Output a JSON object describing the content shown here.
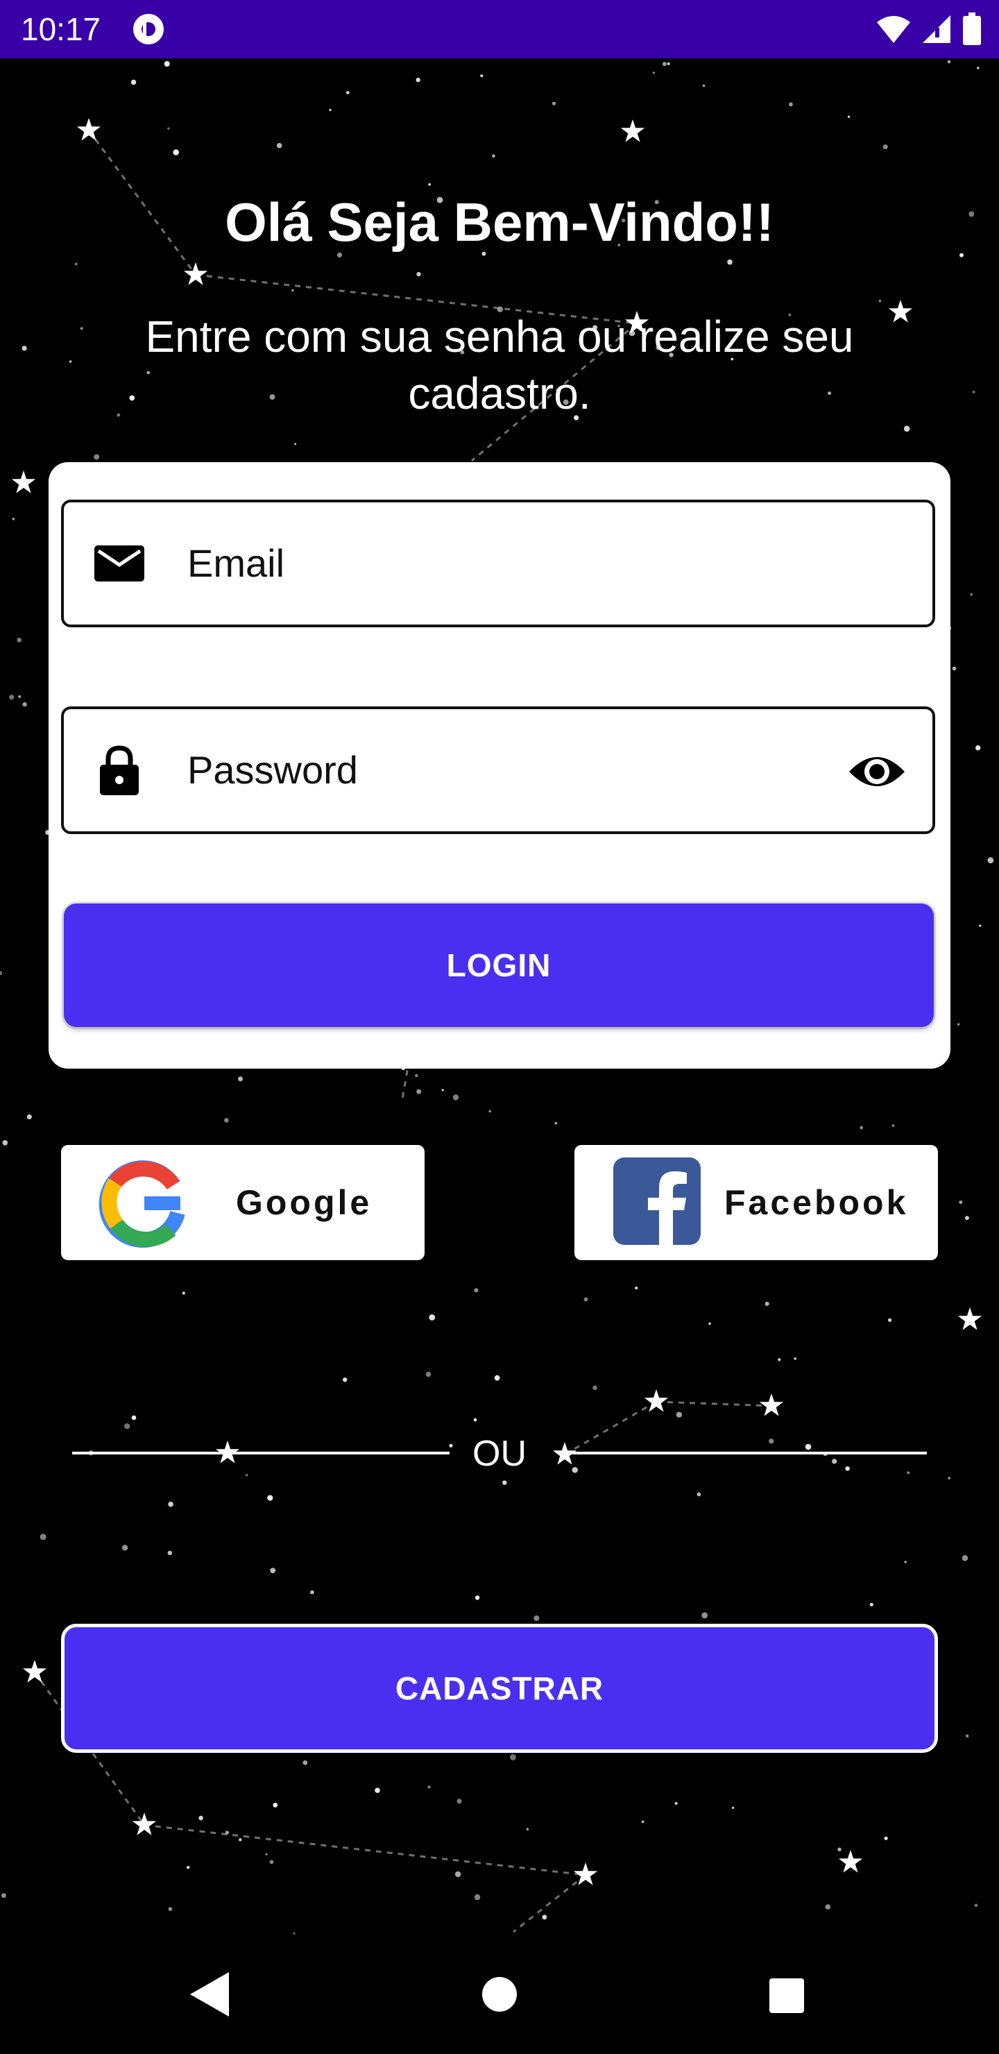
{
  "status_bar": {
    "time": "10:17",
    "icons": [
      "app-notification-icon",
      "wifi-icon",
      "cellular-signal-icon",
      "battery-icon"
    ]
  },
  "welcome": {
    "title": "Olá Seja Bem-Vindo!!",
    "subtitle": "Entre com sua senha ou realize seu cadastro."
  },
  "login_form": {
    "email_placeholder": "Email",
    "email_icon": "envelope-icon",
    "password_placeholder": "Password",
    "password_icon": "lock-icon",
    "password_toggle_icon": "eye-icon",
    "login_label": "LOGIN"
  },
  "social": {
    "google_label": "Google",
    "facebook_label": "Facebook"
  },
  "divider": {
    "label": "OU"
  },
  "register": {
    "label": "CADASTRAR"
  },
  "nav": {
    "icons": [
      "back-icon",
      "home-icon",
      "recents-icon"
    ]
  },
  "colors": {
    "status_bar": "#3a00a8",
    "primary_button": "#4a2ff0",
    "background": "#000000",
    "card": "#ffffff",
    "facebook_blue": "#3b5998"
  }
}
